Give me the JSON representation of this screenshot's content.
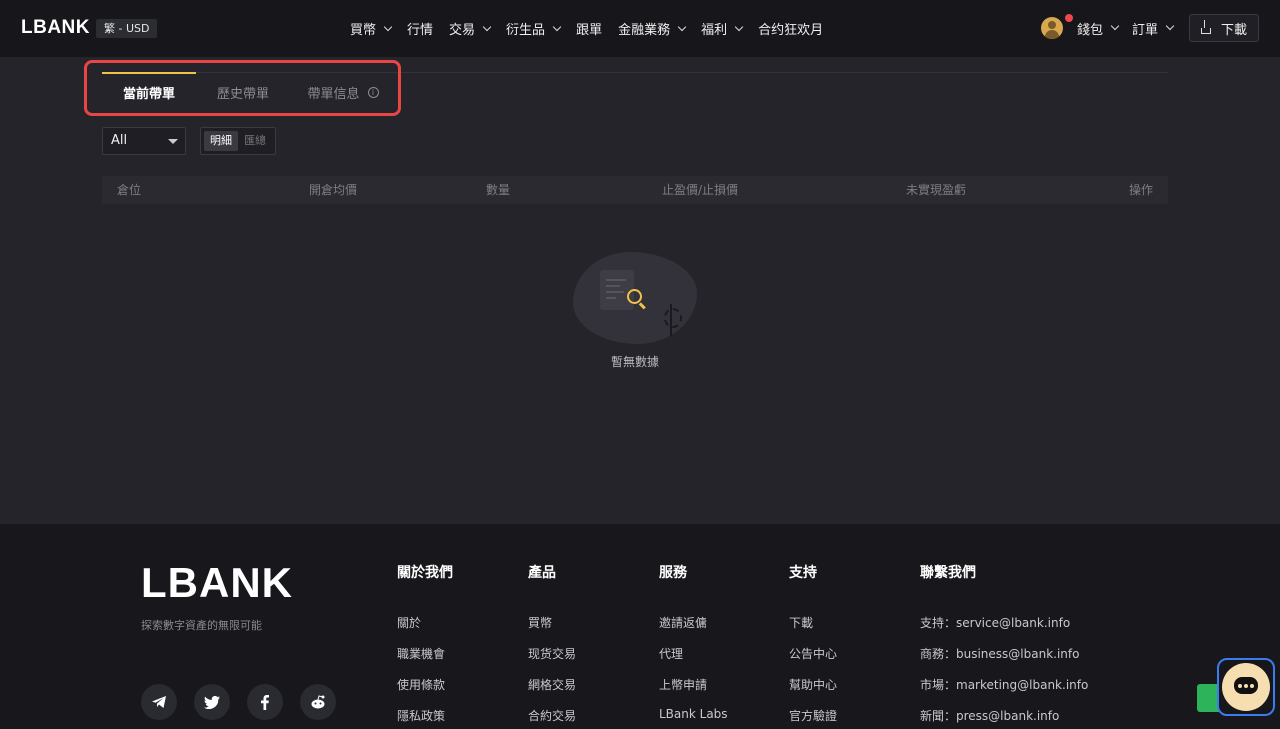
{
  "header": {
    "logo": "LBANK",
    "lang_currency": "繁 - USD",
    "nav": [
      {
        "label": "買幣",
        "dropdown": true
      },
      {
        "label": "行情",
        "dropdown": false
      },
      {
        "label": "交易",
        "dropdown": true
      },
      {
        "label": "衍生品",
        "dropdown": true
      },
      {
        "label": "跟單",
        "dropdown": false
      },
      {
        "label": "金融業務",
        "dropdown": true
      },
      {
        "label": "福利",
        "dropdown": true
      },
      {
        "label": "合约狂欢月",
        "dropdown": false
      }
    ],
    "wallet": "錢包",
    "orders": "訂單",
    "download": "下載"
  },
  "tabs": [
    {
      "label": "當前帶單",
      "active": true
    },
    {
      "label": "歷史帶單",
      "active": false
    },
    {
      "label": "帶單信息",
      "active": false,
      "info_icon": true
    }
  ],
  "filter": {
    "select_value": "All",
    "segments": [
      {
        "label": "明細",
        "active": true
      },
      {
        "label": "匯總",
        "active": false
      }
    ]
  },
  "table": {
    "columns": [
      "倉位",
      "開倉均價",
      "數量",
      "止盈價/止損價",
      "未實現盈虧",
      "操作"
    ]
  },
  "empty": {
    "text": "暫無數據"
  },
  "footer": {
    "logo": "LBANK",
    "slogan": "探索數字資產的無限可能",
    "columns": [
      {
        "title": "關於我們",
        "links": [
          "關於",
          "職業機會",
          "使用條款",
          "隱私政策"
        ]
      },
      {
        "title": "產品",
        "links": [
          "買幣",
          "现货交易",
          "網格交易",
          "合約交易"
        ]
      },
      {
        "title": "服務",
        "links": [
          "邀請返傭",
          "代理",
          "上幣申請",
          "LBank Labs"
        ]
      },
      {
        "title": "支持",
        "links": [
          "下載",
          "公告中心",
          "幫助中心",
          "官方驗證"
        ]
      },
      {
        "title": "聯繫我們",
        "links": [
          "支持：service@lbank.info",
          "商務：business@lbank.info",
          "市場：marketing@lbank.info",
          "新聞：press@lbank.info"
        ]
      }
    ],
    "socials": [
      "telegram-icon",
      "twitter-icon",
      "facebook-icon",
      "reddit-icon"
    ]
  },
  "colors": {
    "accent": "#f0c24a",
    "highlight": "#e84545",
    "page_bg": "#25242b",
    "header_bg": "#16161b"
  }
}
